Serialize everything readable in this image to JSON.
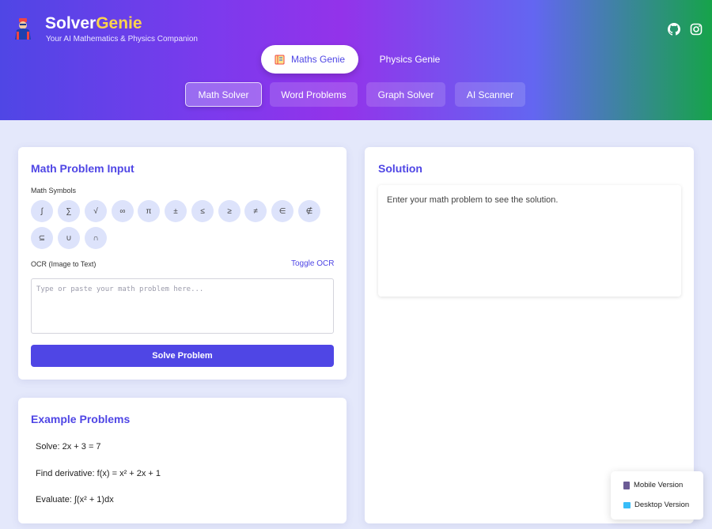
{
  "header": {
    "brand_main": "Solver",
    "brand_accent": "Genie",
    "tagline": "Your AI Mathematics & Physics Companion",
    "social_icons": [
      "github-icon",
      "instagram-icon"
    ],
    "genie_tabs": [
      {
        "label": "Maths Genie",
        "active": true
      },
      {
        "label": "Physics Genie",
        "active": false
      }
    ],
    "sub_tabs": [
      {
        "label": "Math Solver",
        "active": true
      },
      {
        "label": "Word Problems",
        "active": false
      },
      {
        "label": "Graph Solver",
        "active": false
      },
      {
        "label": "AI Scanner",
        "active": false
      }
    ]
  },
  "input_card": {
    "title": "Math Problem Input",
    "symbols_label": "Math Symbols",
    "symbols": [
      "∫",
      "∑",
      "√",
      "∞",
      "π",
      "±",
      "≤",
      "≥",
      "≠",
      "∈",
      "∉",
      "⊆",
      "∪",
      "∩"
    ],
    "ocr_label": "OCR (Image to Text)",
    "ocr_toggle": "Toggle OCR",
    "textarea_placeholder": "Type or paste your math problem here...",
    "solve_button": "Solve Problem"
  },
  "examples_card": {
    "title": "Example Problems",
    "items": [
      "Solve: 2x + 3 = 7",
      "Find derivative: f(x) = x² + 2x + 1",
      "Evaluate: ∫(x² + 1)dx"
    ]
  },
  "solution_card": {
    "title": "Solution",
    "placeholder": "Enter your math problem to see the solution."
  },
  "version_panel": {
    "mobile": "Mobile Version",
    "desktop": "Desktop Version"
  },
  "colors": {
    "accent": "#4f46e5",
    "brand_accent": "#fcd34d",
    "gradient_end": "#16a34a"
  }
}
